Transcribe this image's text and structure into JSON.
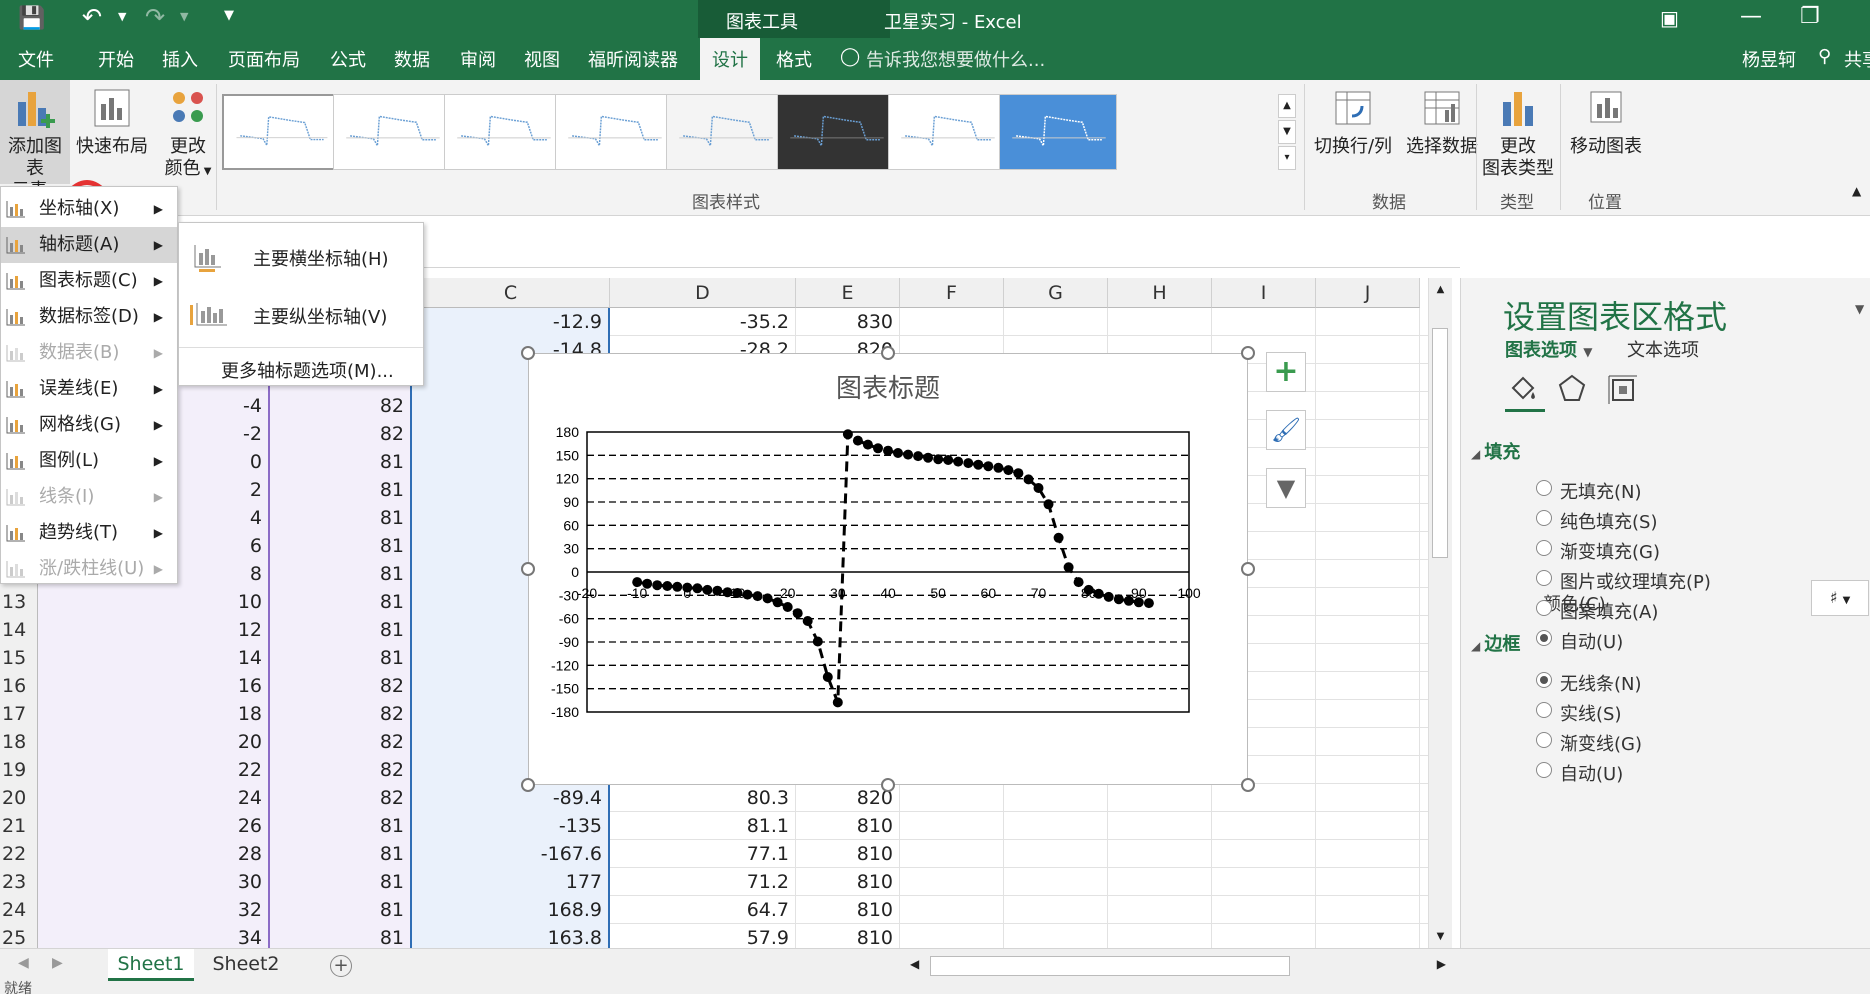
{
  "window": {
    "context_tab": "图表工具",
    "title": "卫星实习 - Excel"
  },
  "tabs": [
    "文件",
    "开始",
    "插入",
    "页面布局",
    "公式",
    "数据",
    "审阅",
    "视图",
    "福昕阅读器",
    "设计",
    "格式"
  ],
  "tellme": "告诉我您想要做什么...",
  "user": "杨昱轲",
  "share": "共享",
  "ribbon": {
    "add_element_line1": "添加图表",
    "add_element_line2": "元素",
    "quick_layout": "快速布局",
    "change_color_line1": "更改",
    "change_color_line2": "颜色",
    "chart_styles_label": "图表样式",
    "switch_rowcol": "切换行/列",
    "select_data": "选择数据",
    "data_label": "数据",
    "change_type_line1": "更改",
    "change_type_line2": "图表类型",
    "type_label": "类型",
    "move_chart": "移动图表",
    "location_label": "位置"
  },
  "menu": {
    "items": [
      {
        "label": "坐标轴(X)",
        "enabled": true
      },
      {
        "label": "轴标题(A)",
        "enabled": true
      },
      {
        "label": "图表标题(C)",
        "enabled": true
      },
      {
        "label": "数据标签(D)",
        "enabled": true
      },
      {
        "label": "数据表(B)",
        "enabled": false
      },
      {
        "label": "误差线(E)",
        "enabled": true
      },
      {
        "label": "网格线(G)",
        "enabled": true
      },
      {
        "label": "图例(L)",
        "enabled": true
      },
      {
        "label": "线条(I)",
        "enabled": false
      },
      {
        "label": "趋势线(T)",
        "enabled": true
      },
      {
        "label": "涨/跌柱线(U)",
        "enabled": false
      }
    ],
    "submenu": {
      "primary_horizontal": "主要横坐标轴(H)",
      "primary_vertical": "主要纵坐标轴(V)",
      "more": "更多轴标题选项(M)..."
    }
  },
  "columns": [
    "C",
    "D",
    "E",
    "F",
    "G",
    "H",
    "I",
    "J"
  ],
  "rows": [
    {
      "num": "",
      "a": "",
      "b": "",
      "c": "-12.9",
      "d": "-35.2",
      "e": "830"
    },
    {
      "num": "",
      "a": "",
      "b": "",
      "c": "-14.8",
      "d": "-28.2",
      "e": "820"
    },
    {
      "num": "",
      "a": "",
      "b": "82",
      "c": "",
      "d": "",
      "e": ""
    },
    {
      "num": "",
      "a": "-4",
      "b": "82",
      "c": "",
      "d": "",
      "e": ""
    },
    {
      "num": "",
      "a": "-2",
      "b": "82",
      "c": "",
      "d": "",
      "e": ""
    },
    {
      "num": "",
      "a": "0",
      "b": "81",
      "c": "",
      "d": "",
      "e": ""
    },
    {
      "num": "",
      "a": "2",
      "b": "81",
      "c": "",
      "d": "",
      "e": ""
    },
    {
      "num": "",
      "a": "4",
      "b": "81",
      "c": "",
      "d": "",
      "e": ""
    },
    {
      "num": "",
      "a": "6",
      "b": "81",
      "c": "",
      "d": "",
      "e": ""
    },
    {
      "num": "",
      "a": "8",
      "b": "81",
      "c": "",
      "d": "",
      "e": ""
    },
    {
      "num": "13",
      "a": "10",
      "b": "81",
      "c": "",
      "d": "",
      "e": ""
    },
    {
      "num": "14",
      "a": "12",
      "b": "81",
      "c": "",
      "d": "",
      "e": ""
    },
    {
      "num": "15",
      "a": "14",
      "b": "81",
      "c": "",
      "d": "",
      "e": ""
    },
    {
      "num": "16",
      "a": "16",
      "b": "82",
      "c": "",
      "d": "",
      "e": ""
    },
    {
      "num": "17",
      "a": "18",
      "b": "82",
      "c": "",
      "d": "",
      "e": ""
    },
    {
      "num": "18",
      "a": "20",
      "b": "82",
      "c": "",
      "d": "",
      "e": ""
    },
    {
      "num": "19",
      "a": "22",
      "b": "82",
      "c": "",
      "d": "",
      "e": ""
    },
    {
      "num": "20",
      "a": "24",
      "b": "82",
      "c": "-89.4",
      "d": "80.3",
      "e": "820"
    },
    {
      "num": "21",
      "a": "26",
      "b": "81",
      "c": "-135",
      "d": "81.1",
      "e": "810"
    },
    {
      "num": "22",
      "a": "28",
      "b": "81",
      "c": "-167.6",
      "d": "77.1",
      "e": "810"
    },
    {
      "num": "23",
      "a": "30",
      "b": "81",
      "c": "177",
      "d": "71.2",
      "e": "810"
    },
    {
      "num": "24",
      "a": "32",
      "b": "81",
      "c": "168.9",
      "d": "64.7",
      "e": "810"
    },
    {
      "num": "25",
      "a": "34",
      "b": "81",
      "c": "163.8",
      "d": "57.9",
      "e": "810"
    }
  ],
  "chart_data": {
    "type": "scatter",
    "title": "图表标题",
    "xlim": [
      -20,
      100
    ],
    "ylim": [
      -180,
      180
    ],
    "xticks": [
      -20,
      -10,
      0,
      10,
      20,
      30,
      40,
      50,
      60,
      70,
      80,
      90,
      100
    ],
    "yticks": [
      180,
      150,
      120,
      90,
      60,
      30,
      0,
      -30,
      -60,
      -90,
      -120,
      -150,
      -180
    ],
    "series": [
      {
        "x": [
          -10,
          -8,
          -6,
          -4,
          -2,
          0,
          2,
          4,
          6,
          8,
          10,
          12,
          14,
          16,
          18,
          20,
          22,
          24,
          26,
          28,
          30,
          32,
          34,
          36,
          38,
          40,
          42,
          44,
          46,
          48,
          50,
          52,
          54,
          56,
          58,
          60,
          62,
          64,
          66,
          68,
          70,
          72,
          74,
          76,
          78,
          80,
          82,
          84,
          86,
          88,
          90,
          92
        ],
        "y": [
          -13,
          -15,
          -17,
          -18,
          -19,
          -20,
          -21,
          -23,
          -24,
          -26,
          -27,
          -29,
          -31,
          -34,
          -39,
          -45,
          -53,
          -63,
          -89.4,
          -135,
          -167.6,
          177,
          168.9,
          163.8,
          159,
          156,
          153,
          151,
          149,
          147,
          145,
          144,
          142,
          140,
          138,
          136,
          134,
          131,
          127,
          119,
          108,
          87,
          44,
          6,
          -13,
          -23,
          -28,
          -32,
          -35,
          -37,
          -39,
          -40
        ]
      }
    ]
  },
  "pane": {
    "title": "设置图表区格式",
    "tab1": "图表选项",
    "tab2": "文本选项",
    "fill_header": "填充",
    "fill_options": [
      {
        "label": "无填充(N)",
        "on": false
      },
      {
        "label": "纯色填充(S)",
        "on": false
      },
      {
        "label": "渐变填充(G)",
        "on": false
      },
      {
        "label": "图片或纹理填充(P)",
        "on": false
      },
      {
        "label": "图案填充(A)",
        "on": false
      },
      {
        "label": "自动(U)",
        "on": true
      }
    ],
    "color_label": "颜色(C)",
    "border_header": "边框",
    "border_options": [
      {
        "label": "无线条(N)",
        "on": true
      },
      {
        "label": "实线(S)",
        "on": false
      },
      {
        "label": "渐变线(G)",
        "on": false
      },
      {
        "label": "自动(U)",
        "on": false
      }
    ]
  },
  "sheets": [
    "Sheet1",
    "Sheet2"
  ],
  "status": "就绪"
}
